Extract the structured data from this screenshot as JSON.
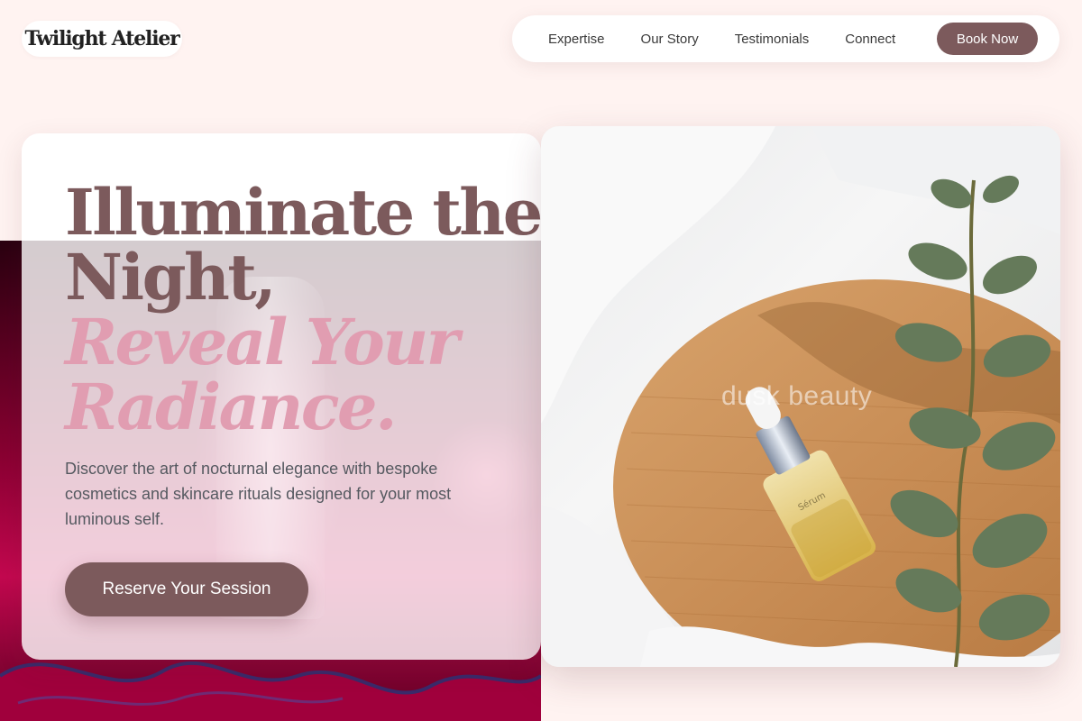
{
  "brand": {
    "name": "Twilight Atelier"
  },
  "nav": {
    "links": [
      "Expertise",
      "Our Story",
      "Testimonials",
      "Connect"
    ],
    "cta": "Book Now"
  },
  "hero": {
    "title_line1": "Illuminate the",
    "title_line2": "Night,",
    "accent_line1": "Reveal Your",
    "accent_line2": "Radiance.",
    "description": "Discover the art of nocturnal elegance with bespoke cosmetics and skincare rituals designed for your most luminous self.",
    "cta": "Reserve Your Session"
  },
  "product_image": {
    "watermark": "dusk beauty",
    "bottle_label": "Sérum"
  },
  "colors": {
    "page_bg": "#fff3f1",
    "brand_mauve": "#7c5a5c",
    "accent_pink": "#e19db1",
    "text_muted": "#555960"
  }
}
